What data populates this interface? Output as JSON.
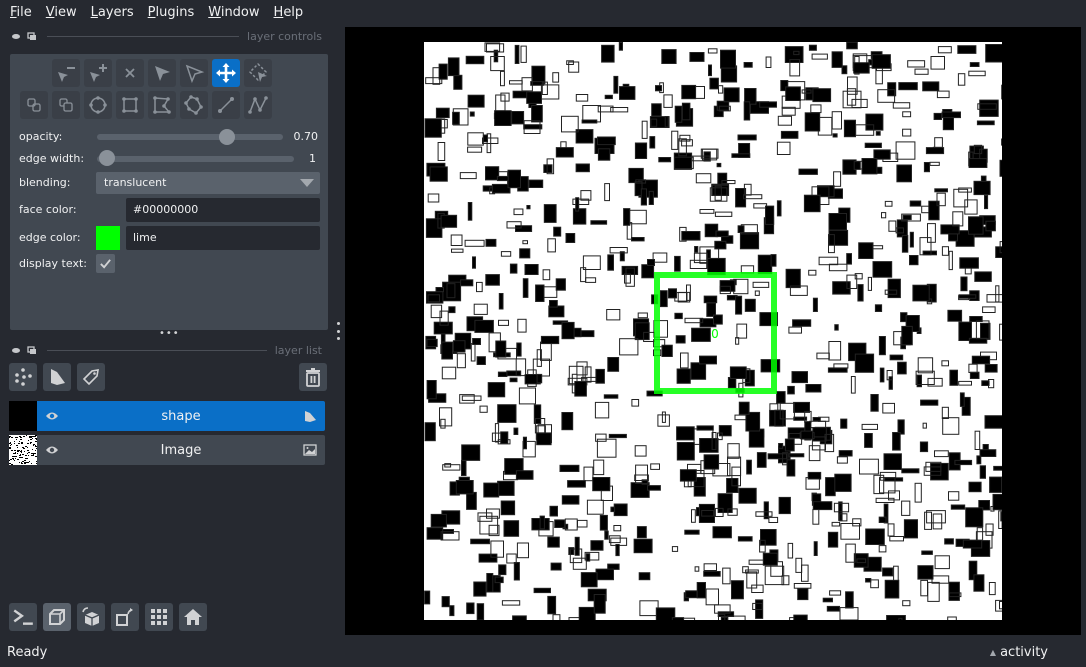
{
  "menubar": {
    "items": [
      {
        "label": "File",
        "mnemonic": "F",
        "rest": "ile"
      },
      {
        "label": "View",
        "mnemonic": "V",
        "rest": "iew"
      },
      {
        "label": "Layers",
        "mnemonic": "L",
        "rest": "ayers"
      },
      {
        "label": "Plugins",
        "mnemonic": "P",
        "rest": "lugins"
      },
      {
        "label": "Window",
        "mnemonic": "W",
        "rest": "indow"
      },
      {
        "label": "Help",
        "mnemonic": "H",
        "rest": "elp"
      }
    ]
  },
  "layer_controls": {
    "title": "layer controls",
    "tools_row1": [
      "remove-vertex",
      "add-vertex",
      "delete-shape",
      "select-shape",
      "select-vertex",
      "pan-zoom",
      "transform"
    ],
    "tools_row2": [
      "move-back",
      "move-front",
      "add-ellipse",
      "add-rectangle",
      "add-polygon-lasso",
      "add-polygon",
      "add-line",
      "add-path"
    ],
    "active_tool": "pan-zoom",
    "opacity": {
      "label": "opacity:",
      "value": "0.70",
      "fraction": 0.7
    },
    "edge_width": {
      "label": "edge width:",
      "value": "1",
      "fraction": 0.05
    },
    "blending": {
      "label": "blending:",
      "value": "translucent"
    },
    "face_color": {
      "label": "face color:",
      "value": "#00000000"
    },
    "edge_color": {
      "label": "edge color:",
      "value": "lime",
      "swatch": "#00ff00"
    },
    "display_text": {
      "label": "display text:",
      "checked": true,
      "check_glyph": "✓"
    }
  },
  "layer_list": {
    "title": "layer list",
    "layers": [
      {
        "name": "shape",
        "type": "shapes",
        "selected": true,
        "visible": true
      },
      {
        "name": "Image",
        "type": "image",
        "selected": false,
        "visible": true
      }
    ]
  },
  "canvas": {
    "shape_text": "0",
    "edge_color": "#00ff00"
  },
  "status": {
    "text": "Ready",
    "activity_label": "activity",
    "activity_glyph": "▲"
  },
  "colors": {
    "background": "#262930",
    "panel": "#414851",
    "accent": "#0a6fc7",
    "selected_layer": "#0a6fc7"
  }
}
